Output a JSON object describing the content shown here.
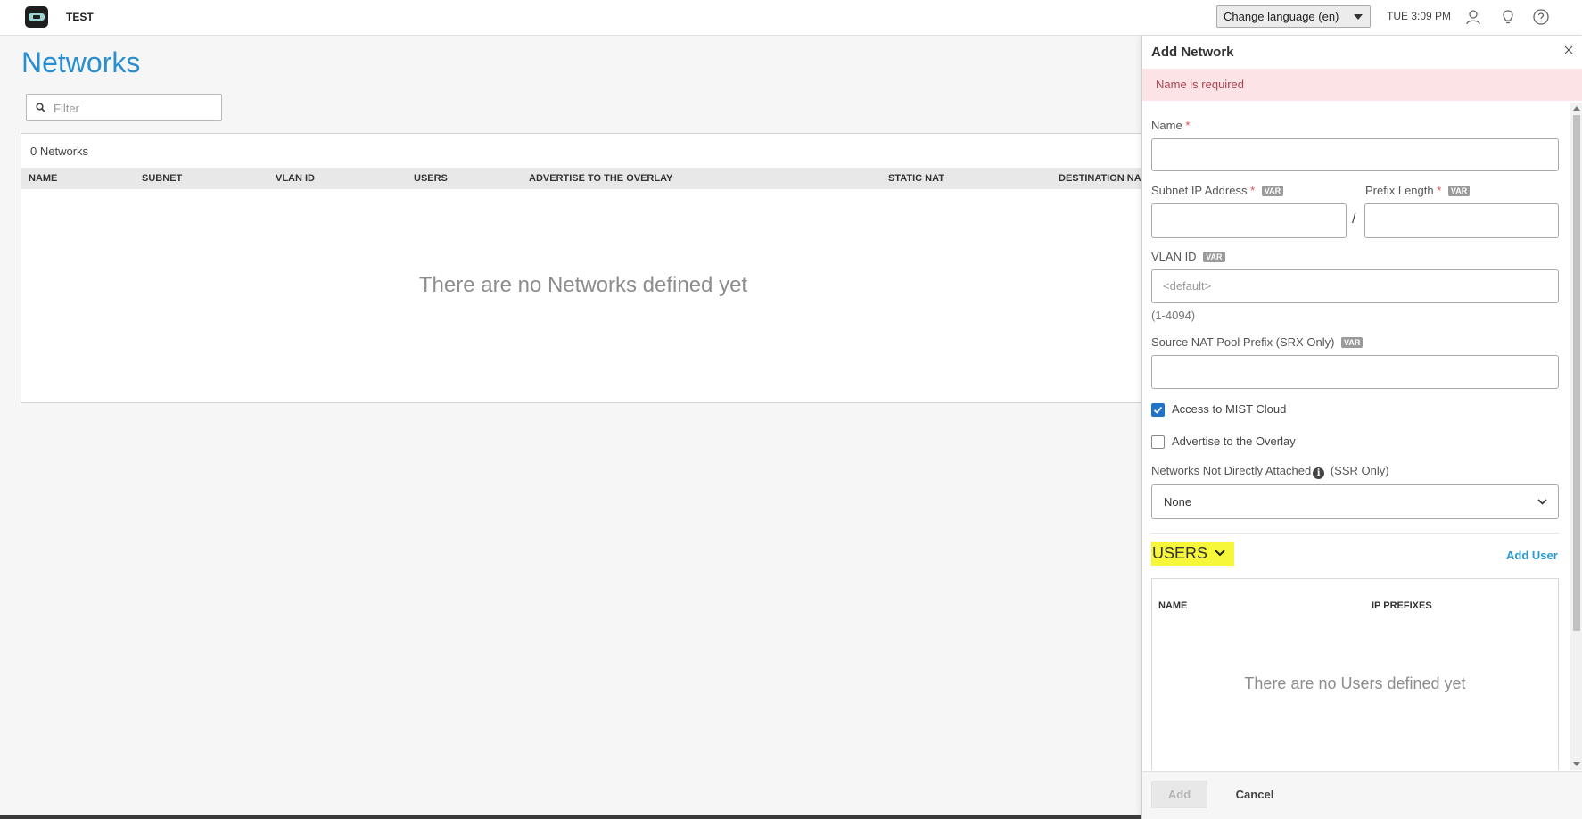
{
  "header": {
    "org_name": "TEST",
    "language_select": "Change language (en)",
    "clock": "TUE 3:09 PM"
  },
  "main": {
    "title": "Networks",
    "filter_placeholder": "Filter",
    "count": "0 Networks",
    "columns": [
      "NAME",
      "SUBNET",
      "VLAN ID",
      "USERS",
      "ADVERTISE TO THE OVERLAY",
      "STATIC NAT",
      "DESTINATION NA"
    ],
    "empty_message": "There are no Networks defined yet"
  },
  "drawer": {
    "title": "Add Network",
    "error": "Name is required",
    "name_label": "Name",
    "required_mark": "*",
    "var_badge": "VAR",
    "subnet_label": "Subnet IP Address",
    "prefix_label": "Prefix Length",
    "slash": "/",
    "vlan_label": "VLAN ID",
    "vlan_placeholder": "<default>",
    "vlan_hint": "(1-4094)",
    "source_nat_label": "Source NAT Pool Prefix (SRX Only)",
    "access_mist_label": "Access to MIST Cloud",
    "access_mist_checked": true,
    "advertise_label": "Advertise to the Overlay",
    "advertise_checked": false,
    "not_attached_label": "Networks Not Directly Attached",
    "not_attached_suffix": "(SSR Only)",
    "not_attached_value": "None",
    "users_heading": "USERS",
    "add_user": "Add User",
    "users_columns": [
      "NAME",
      "IP PREFIXES"
    ],
    "users_empty": "There are no Users defined yet",
    "add_button": "Add",
    "cancel_button": "Cancel"
  },
  "colors": {
    "title_blue": "#2a8fd1",
    "error_bg": "#fbe3e6",
    "highlight": "#f7f73a",
    "checkbox_blue": "#1f74c8",
    "link_blue": "#2a9ad6"
  }
}
